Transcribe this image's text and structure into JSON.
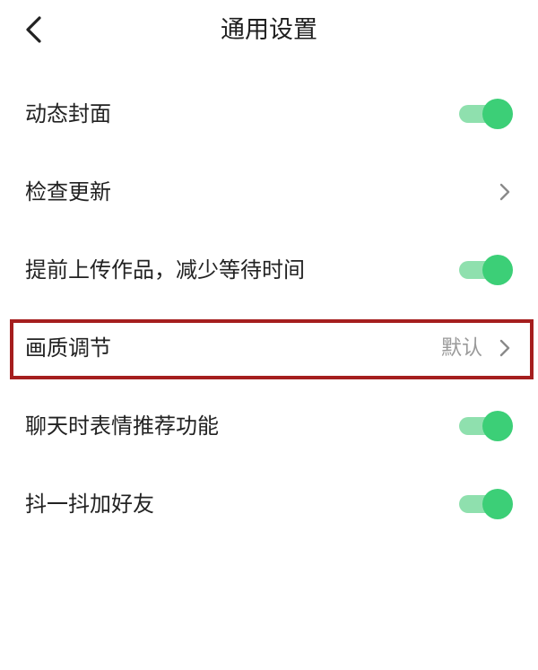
{
  "header": {
    "title": "通用设置",
    "back_icon": "chevron-left-icon"
  },
  "settings": [
    {
      "label": "动态封面",
      "control": "toggle",
      "enabled": true
    },
    {
      "label": "检查更新",
      "control": "chevron"
    },
    {
      "label": "提前上传作品，减少等待时间",
      "control": "toggle",
      "enabled": true
    },
    {
      "label": "画质调节",
      "control": "chevron",
      "value": "默认",
      "highlighted": true
    },
    {
      "label": "聊天时表情推荐功能",
      "control": "toggle",
      "enabled": true
    },
    {
      "label": "抖一抖加好友",
      "control": "toggle",
      "enabled": true
    }
  ],
  "colors": {
    "toggle_on_knob": "#3ccf77",
    "toggle_on_track": "#8fe0ae",
    "highlight_border": "#a51e1e",
    "value_text": "#9a9a9a"
  }
}
